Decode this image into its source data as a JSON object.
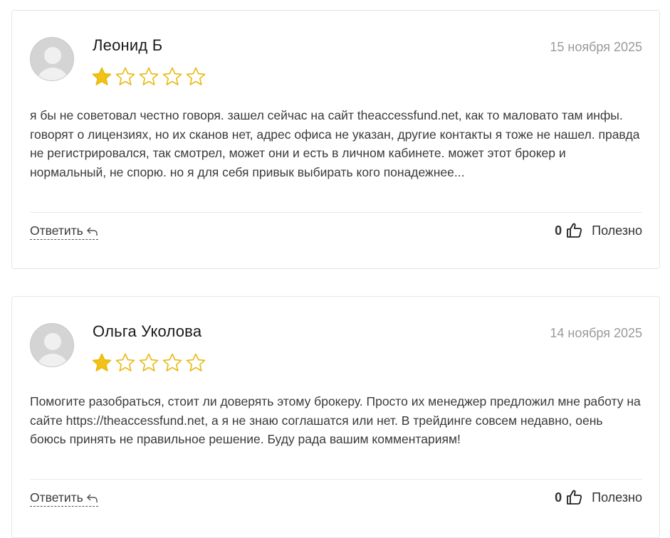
{
  "reviews": [
    {
      "author": "Леонид Б",
      "date": "15 ноября 2025",
      "rating": 1,
      "text": "я бы не советовал честно говоря. зашел сейчас на сайт theaccessfund.net, как то маловато там инфы. говорят о лицензиях, но их сканов нет, адрес офиса не указан, другие контакты я тоже не нашел. правда не регистрировался, так смотрел, может они и есть в личном кабинете. может этот брокер и нормальный, не спорю. но я для себя привык выбирать кого понадежнее...",
      "reply_label": "Ответить",
      "votes": "0",
      "useful_label": "Полезно"
    },
    {
      "author": "Ольга Уколова",
      "date": "14 ноября 2025",
      "rating": 1,
      "text": "Помогите разобраться, стоит ли доверять этому брокеру. Просто их менеджер предложил мне работу на сайте https://theaccessfund.net, а я не знаю соглашатся или нет. В трейдинге совсем недавно, оень боюсь принять не правильное решение. Буду рада вашим комментариям!",
      "reply_label": "Ответить",
      "votes": "0",
      "useful_label": "Полезно"
    }
  ],
  "colors": {
    "star_filled": "#F2C316",
    "star_outline": "#E8B90F",
    "date": "#9a9a9a"
  },
  "icons": {
    "avatar": "user-placeholder-icon",
    "star": "star-icon",
    "reply": "reply-arrow-icon",
    "thumb": "thumbs-up-icon"
  }
}
